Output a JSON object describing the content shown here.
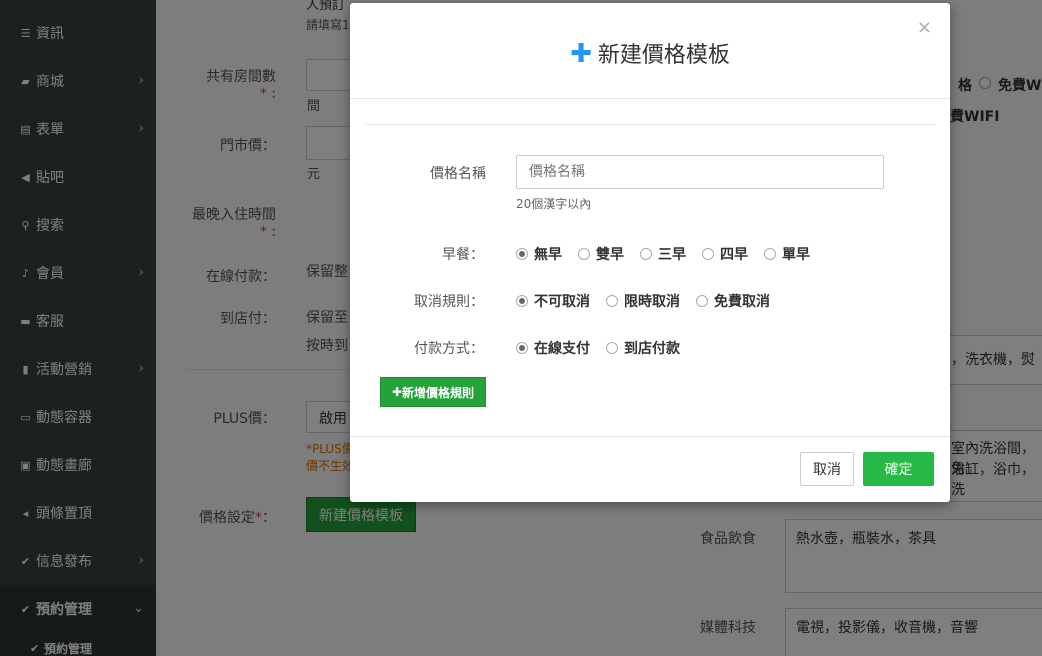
{
  "sidebar": {
    "items": [
      {
        "label": "資訊",
        "icon": "list-icon",
        "chevron": false
      },
      {
        "label": "商城",
        "icon": "cart-icon",
        "chevron": true
      },
      {
        "label": "表單",
        "icon": "form-icon",
        "chevron": true
      },
      {
        "label": "貼吧",
        "icon": "megaphone-icon",
        "chevron": false
      },
      {
        "label": "搜索",
        "icon": "search-icon",
        "chevron": false
      },
      {
        "label": "會員",
        "icon": "bell-icon",
        "chevron": true
      },
      {
        "label": "客服",
        "icon": "chat-icon",
        "chevron": false
      },
      {
        "label": "活動營銷",
        "icon": "bookmark-icon",
        "chevron": true
      },
      {
        "label": "動態容器",
        "icon": "hdd-icon",
        "chevron": false
      },
      {
        "label": "動態畫廊",
        "icon": "picture-icon",
        "chevron": false
      },
      {
        "label": "頭條置頂",
        "icon": "volume-icon",
        "chevron": false
      },
      {
        "label": "信息發布",
        "icon": "check-icon",
        "chevron": true
      },
      {
        "label": "預約管理",
        "icon": "check-icon",
        "chevron": true,
        "active": true
      }
    ],
    "sub_item": "預約管理"
  },
  "background": {
    "top_partial": "人預訂",
    "top_hint": "請填寫1",
    "rooms_label": "共有房間數",
    "rooms_unit": "間",
    "price_label": "門市價：",
    "price_unit": "元",
    "latest_checkin_label": "最晚入住時間",
    "online_pay_label": "在線付款：",
    "online_pay_value": "保留整",
    "store_pay_label": "到店付：",
    "store_pay_value": "保留至",
    "store_pay_value2": "按時到",
    "plus_label": "PLUS價：",
    "plus_select": "啟用",
    "plus_note1": "*PLUS價",
    "plus_note2": "價不生效",
    "price_setting_label": "價格設定",
    "new_template_btn": "新建價格模板",
    "right_radio_a": "格",
    "right_radio_b": "免費W",
    "right_wifi": "費WIFI",
    "right_line1": "，洗衣機，熨",
    "right_line2": "室內洗浴間，免",
    "right_line3": "浴缸，浴巾，洗",
    "food_label": "食品飲食",
    "food_value": "熱水壺，瓶裝水，茶具",
    "media_label": "媒體科技",
    "media_value": "電視，投影儀，收音機，音響"
  },
  "modal": {
    "title": "新建價格模板",
    "close": "×",
    "name_label": "價格名稱",
    "name_placeholder": "價格名稱",
    "name_help": "20個漢字以內",
    "breakfast_label": "早餐：",
    "breakfast_options": [
      "無早",
      "雙早",
      "三早",
      "四早",
      "單早"
    ],
    "breakfast_selected": 0,
    "cancel_rule_label": "取消規則：",
    "cancel_rule_options": [
      "不可取消",
      "限時取消",
      "免費取消"
    ],
    "cancel_rule_selected": 0,
    "payment_label": "付款方式：",
    "payment_options": [
      "在線支付",
      "到店付款"
    ],
    "payment_selected": 0,
    "add_rule_btn": "新增價格規則",
    "cancel_btn": "取消",
    "ok_btn": "確定"
  },
  "colors": {
    "sidebar_bg": "#3b4143",
    "accent_green": "#25b945",
    "plus_blue": "#2196f3"
  }
}
